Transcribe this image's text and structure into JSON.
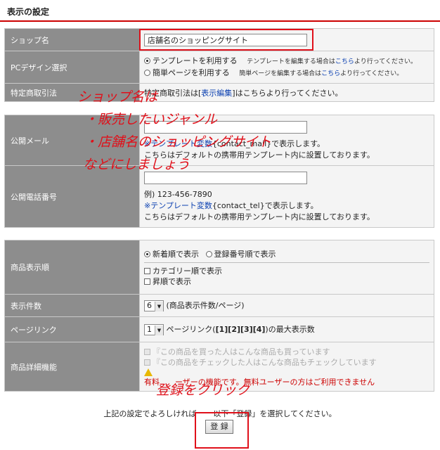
{
  "header": {
    "title": "表示の設定"
  },
  "shop": {
    "label": "ショップ名",
    "value": "店舗名のショッピングサイト"
  },
  "pc_design": {
    "label": "PCデザイン選択",
    "option1": "テンプレートを利用する",
    "option1_note_pre": "テンプレートを編集する場合は",
    "option1_link": "こちら",
    "option1_note_post": "より行ってください。",
    "option2": "簡単ページを利用する",
    "option2_note_pre": "簡単ページを編集する場合は",
    "option2_link": "こちら",
    "option2_note_post": "より行ってください。",
    "selected": "テンプレートを利用する"
  },
  "tokushoho": {
    "label": "特定商取引法",
    "text_pre": "特定商取引法は[",
    "link": "表示編集",
    "text_post": "]はこちらより行ってください。"
  },
  "public_mail": {
    "label": "公開メール",
    "value": "",
    "template_link": "※テンプレート変数",
    "var_text": "{contact_mail}で表示します。",
    "note": "こちらはデフォルトの携帯用テンプレート内に設置しております。"
  },
  "public_tel": {
    "label": "公開電話番号",
    "value": "",
    "example": "例) 123-456-7890",
    "template_link": "※テンプレート変数",
    "var_text": "{contact_tel}で表示します。",
    "note": "こちらはデフォルトの携帯用テンプレート内に設置しております。"
  },
  "product_order": {
    "label": "商品表示順",
    "radio1": "新着順で表示",
    "radio2": "登録番号順で表示",
    "selected": "新着順で表示",
    "check1": "カテゴリー順で表示",
    "check2": "昇順で表示"
  },
  "display_count": {
    "label": "表示件数",
    "value": "6",
    "suffix": "(商品表示件数/ページ)"
  },
  "page_link": {
    "label": "ページリンク",
    "value": "1",
    "text_pre": "ページリンク(",
    "bold": "[1][2][3][4]",
    "text_post": ")の最大表示数"
  },
  "product_detail": {
    "label": "商品詳細機能",
    "check1": "『この商品を買った人はこんな商品も買っています",
    "check2": "『この商品をチェックした人はこんな商品もチェックしています",
    "warning_a": "有料",
    "warning_b": "ーザーの機能です。無料ユーザーの方はご利用できません"
  },
  "footer": {
    "note_a": "上記の設定でよろしければ",
    "note_b": "以下「登録」を選択してください。",
    "register_label": "登 録"
  },
  "annotations": {
    "note_line1": "ショップ名は",
    "note_line2": "・販売したいジャンル",
    "note_line3": "・店舗名のショッピングサイト",
    "note_line4": "などにしましょう",
    "register_note": "登録をクリック"
  },
  "colors": {
    "label_bg": "#8d8d8d",
    "value_bg": "#f4f4f4",
    "header_rule": "#cc0000",
    "highlight": "#e0101a",
    "link": "#0a3fb0"
  }
}
